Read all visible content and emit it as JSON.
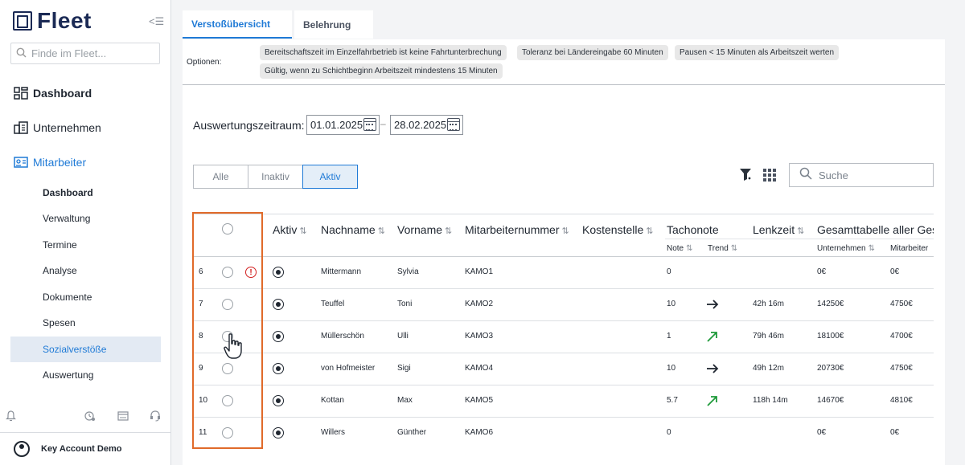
{
  "sidebar": {
    "logo_text": "Fleet",
    "search_placeholder": "Finde im Fleet...",
    "main_items": [
      {
        "label": "Dashboard",
        "icon": "dashboard-icon"
      },
      {
        "label": "Unternehmen",
        "icon": "building-icon"
      },
      {
        "label": "Mitarbeiter",
        "icon": "id-card-icon"
      }
    ],
    "sub_items": [
      {
        "label": "Dashboard"
      },
      {
        "label": "Verwaltung"
      },
      {
        "label": "Termine"
      },
      {
        "label": "Analyse"
      },
      {
        "label": "Dokumente"
      },
      {
        "label": "Spesen"
      },
      {
        "label": "Sozialverstöße"
      },
      {
        "label": "Auswertung"
      }
    ],
    "user_name": "Key Account Demo"
  },
  "tabs": [
    {
      "label": "Verstoßübersicht"
    },
    {
      "label": "Belehrung"
    }
  ],
  "options": {
    "label": "Optionen:",
    "chips": [
      "Bereitschaftszeit im Einzelfahrbetrieb ist keine Fahrtunterbrechung",
      "Toleranz bei Ländereingabe 60 Minuten",
      "Pausen < 15 Minuten als Arbeitszeit werten",
      "Gültig, wenn zu Schichtbeginn Arbeitszeit mindestens 15 Minuten"
    ]
  },
  "period": {
    "label": "Auswertungszeitraum:",
    "from": "01.01.2025",
    "to": "28.02.2025",
    "separator": "–"
  },
  "filter_segments": [
    {
      "label": "Alle"
    },
    {
      "label": "Inaktiv"
    },
    {
      "label": "Aktiv"
    }
  ],
  "search_placeholder": "Suche",
  "table": {
    "headers": {
      "aktiv": "Aktiv",
      "nachname": "Nachname",
      "vorname": "Vorname",
      "mitarbeiternummer": "Mitarbeiternummer",
      "kostenstelle": "Kostenstelle",
      "tachonote": "Tachonote",
      "note": "Note",
      "trend": "Trend",
      "lenkzeit": "Lenkzeit",
      "gesamttabelle": "Gesamttabelle aller Gese",
      "unternehmen": "Unternehmen",
      "mitarbeiter": "Mitarbeiter"
    },
    "sort_glyph": "⇅",
    "rows": [
      {
        "nr": "6",
        "warning": true,
        "nachname": "Mittermann",
        "vorname": "Sylvia",
        "nummer": "KAMO1",
        "note": "0",
        "trend": "",
        "lenkzeit": "",
        "unternehmen": "0€",
        "mitarbeiter": "0€"
      },
      {
        "nr": "7",
        "warning": false,
        "nachname": "Teuffel",
        "vorname": "Toni",
        "nummer": "KAMO2",
        "note": "10",
        "trend": "right",
        "lenkzeit": "42h 16m",
        "unternehmen": "14250€",
        "mitarbeiter": "4750€"
      },
      {
        "nr": "8",
        "warning": false,
        "nachname": "Müllerschön",
        "vorname": "Ulli",
        "nummer": "KAMO3",
        "note": "1",
        "trend": "up",
        "lenkzeit": "79h 46m",
        "unternehmen": "18100€",
        "mitarbeiter": "4700€"
      },
      {
        "nr": "9",
        "warning": false,
        "nachname": "von Hofmeister",
        "vorname": "Sigi",
        "nummer": "KAMO4",
        "note": "10",
        "trend": "right",
        "lenkzeit": "49h 12m",
        "unternehmen": "20730€",
        "mitarbeiter": "4750€"
      },
      {
        "nr": "10",
        "warning": false,
        "nachname": "Kottan",
        "vorname": "Max",
        "nummer": "KAMO5",
        "note": "5.7",
        "trend": "up",
        "lenkzeit": "118h 14m",
        "unternehmen": "14670€",
        "mitarbeiter": "4810€"
      },
      {
        "nr": "11",
        "warning": false,
        "nachname": "Willers",
        "vorname": "Günther",
        "nummer": "KAMO6",
        "note": "0",
        "trend": "",
        "lenkzeit": "",
        "unternehmen": "0€",
        "mitarbeiter": "0€"
      }
    ]
  },
  "colors": {
    "accent": "#1f7ad6",
    "highlight": "#e06a2a",
    "trend_up": "#1e9a3a",
    "warning": "#d21f1f"
  }
}
